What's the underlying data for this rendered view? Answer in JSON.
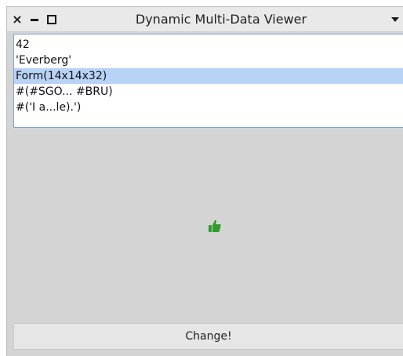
{
  "window": {
    "title": "Dynamic Multi-Data Viewer",
    "close_glyph": "×"
  },
  "list": {
    "items": [
      "42",
      "'Everberg'",
      "Form(14x14x32)",
      "#(#SGO... #BRU)",
      "#('I a...le).')"
    ],
    "selected_index": 2
  },
  "display": {
    "icon": "thumbs-up-icon",
    "icon_color": "#2e9b2e"
  },
  "footer": {
    "button_label": "Change!"
  }
}
